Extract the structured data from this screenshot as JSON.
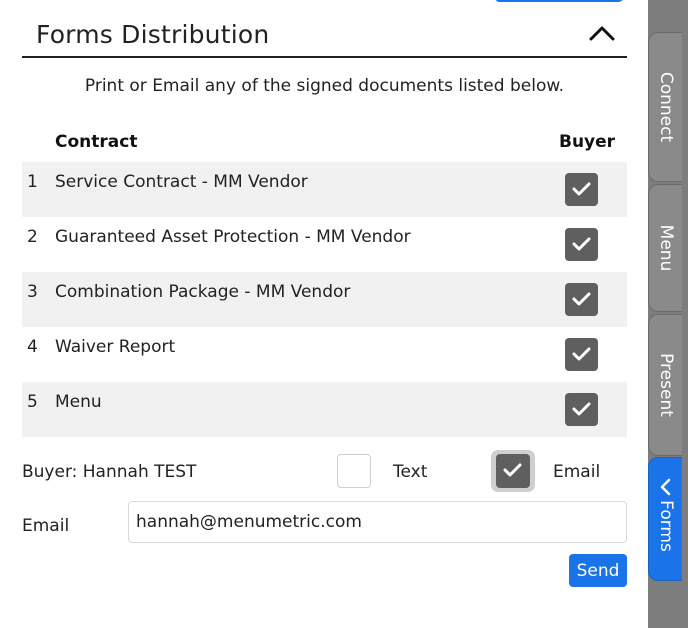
{
  "panel": {
    "title": "Forms Distribution",
    "subtitle": "Print or Email any of the signed documents listed below.",
    "columns": {
      "contract": "Contract",
      "buyer": "Buyer"
    },
    "documents": [
      {
        "num": "1",
        "name": "Service Contract - MM Vendor",
        "checked": true
      },
      {
        "num": "2",
        "name": "Guaranteed Asset Protection - MM Vendor",
        "checked": true
      },
      {
        "num": "3",
        "name": "Combination Package - MM Vendor",
        "checked": true
      },
      {
        "num": "4",
        "name": "Waiver Report",
        "checked": true
      },
      {
        "num": "5",
        "name": "Menu",
        "checked": true
      }
    ],
    "buyer_line": "Buyer: Hannah TEST",
    "delivery": {
      "text_label": "Text",
      "text_checked": false,
      "email_label": "Email",
      "email_checked": true
    },
    "email_field": {
      "label": "Email",
      "value": "hannah@menumetric.com"
    },
    "send_label": "Send"
  },
  "side_tabs": {
    "connect": "Connect",
    "menu": "Menu",
    "present": "Present",
    "forms": "Forms",
    "active": "forms"
  },
  "colors": {
    "accent": "#1a73e8",
    "checkbox": "#5f5f5f",
    "rail": "#7d7d7d",
    "row_shade": "#f1f1f1"
  },
  "icons": {
    "collapse": "chevron-up-icon",
    "check": "checkmark-icon",
    "forms_tab": "chevron-left-icon"
  }
}
